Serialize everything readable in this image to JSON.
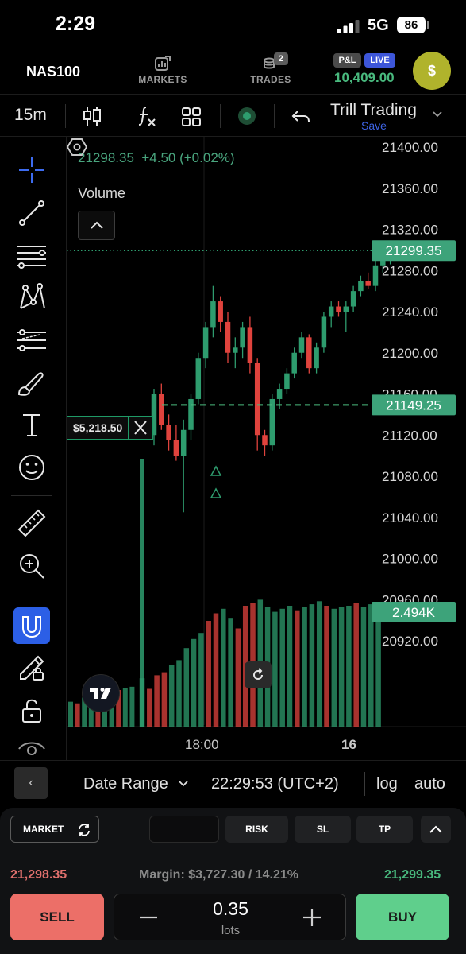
{
  "status_bar": {
    "time": "2:29",
    "network": "5G",
    "battery": "86"
  },
  "header": {
    "symbol": "NAS100",
    "markets_label": "MARKETS",
    "trades_label": "TRADES",
    "trades_count": "2",
    "pl_badge": "P&L",
    "live_badge": "LIVE",
    "balance": "10,409.00",
    "avatar_symbol": "$",
    "accent_color": "#49b97e",
    "avatar_color": "#b0b32c"
  },
  "toolbar": {
    "timeframe": "15m",
    "icons": [
      "candles-icon",
      "indicators-icon",
      "layouts-icon",
      "record-icon",
      "undo-icon"
    ],
    "layout_name": "Trill Trading",
    "save_label": "Save"
  },
  "left_tools": [
    "crosshair-icon",
    "trendline-icon",
    "fib-icon",
    "pattern-icon",
    "forecast-icon",
    "brush-icon",
    "text-icon",
    "emoji-icon",
    "ruler-icon",
    "zoom-icon",
    "magnet-icon",
    "lock-drawings-icon",
    "unlock-icon",
    "eye-icon"
  ],
  "chart": {
    "legend_price": "21298.35",
    "legend_change": "+4.50 (+0.02%)",
    "volume_label": "Volume",
    "position_pnl": "$5,218.50",
    "price_labels": [
      "21400.00",
      "21360.00",
      "21320.00",
      "21280.00",
      "21240.00",
      "21200.00",
      "21160.00",
      "21120.00",
      "21080.00",
      "21040.00",
      "21000.00",
      "20960.00",
      "20920.00"
    ],
    "current_price_tag": "21299.35",
    "entry_price_tag": "21149.25",
    "volume_tag": "2.494K",
    "time_labels": [
      "18:00",
      "16"
    ],
    "up_color": "#2e9c6e",
    "down_color": "#e0433d"
  },
  "chart_data": {
    "type": "candlestick",
    "ylim": [
      20890,
      21410
    ],
    "current_price": 21299.35,
    "entry_price": 21149.25,
    "ohlc": [
      [
        21120,
        21165,
        21110,
        21160
      ],
      [
        21160,
        21170,
        21125,
        21130
      ],
      [
        21130,
        21140,
        21105,
        21115
      ],
      [
        21115,
        21130,
        21095,
        21100
      ],
      [
        21100,
        21135,
        21045,
        21125
      ],
      [
        21125,
        21160,
        21115,
        21155
      ],
      [
        21155,
        21200,
        21150,
        21195
      ],
      [
        21195,
        21230,
        21185,
        21225
      ],
      [
        21225,
        21265,
        21215,
        21250
      ],
      [
        21250,
        21255,
        21220,
        21230
      ],
      [
        21230,
        21240,
        21190,
        21200
      ],
      [
        21200,
        21215,
        21185,
        21205
      ],
      [
        21205,
        21230,
        21195,
        21225
      ],
      [
        21225,
        21235,
        21180,
        21190
      ],
      [
        21190,
        21195,
        21105,
        21120
      ],
      [
        21120,
        21125,
        21100,
        21110
      ],
      [
        21110,
        21160,
        21105,
        21155
      ],
      [
        21155,
        21170,
        21145,
        21165
      ],
      [
        21165,
        21185,
        21160,
        21180
      ],
      [
        21180,
        21205,
        21175,
        21200
      ],
      [
        21200,
        21220,
        21195,
        21215
      ],
      [
        21215,
        21218,
        21180,
        21185
      ],
      [
        21185,
        21210,
        21180,
        21205
      ],
      [
        21205,
        21240,
        21200,
        21235
      ],
      [
        21235,
        21250,
        21225,
        21245
      ],
      [
        21245,
        21250,
        21235,
        21240
      ],
      [
        21240,
        21250,
        21220,
        21245
      ],
      [
        21245,
        21265,
        21240,
        21260
      ],
      [
        21260,
        21275,
        21255,
        21270
      ],
      [
        21270,
        21278,
        21262,
        21265
      ],
      [
        21265,
        21290,
        21260,
        21285
      ],
      [
        21285,
        21300,
        21278,
        21293
      ],
      [
        21293,
        21308,
        21286,
        21299
      ]
    ],
    "volume": [
      0.32,
      0.25,
      0.34,
      0.36,
      0.41,
      0.44,
      0.52,
      0.58,
      0.62,
      0.7,
      0.75,
      0.78,
      0.72,
      0.65,
      0.8,
      0.82,
      0.84,
      0.79,
      0.76,
      0.78,
      0.8,
      0.77,
      0.79,
      0.81,
      0.83,
      0.8,
      0.78,
      0.79,
      0.8,
      0.82,
      0.79,
      0.81,
      0.8
    ]
  },
  "range_bar": {
    "back_symbol": "‹",
    "date_range_label": "Date Range",
    "clock": "22:29:53 (UTC+2)",
    "log_label": "log",
    "auto_label": "auto"
  },
  "order_panel": {
    "order_type": "MARKET",
    "risk_label": "RISK",
    "sl_label": "SL",
    "tp_label": "TP",
    "bid_price": "21,298.35",
    "margin_text": "Margin: $3,727.30 / 14.21%",
    "ask_price": "21,299.35",
    "sell_label": "SELL",
    "buy_label": "BUY",
    "quantity": "0.35",
    "quantity_unit": "lots",
    "sell_color": "#ec6f68",
    "buy_color": "#5fcf8c"
  }
}
